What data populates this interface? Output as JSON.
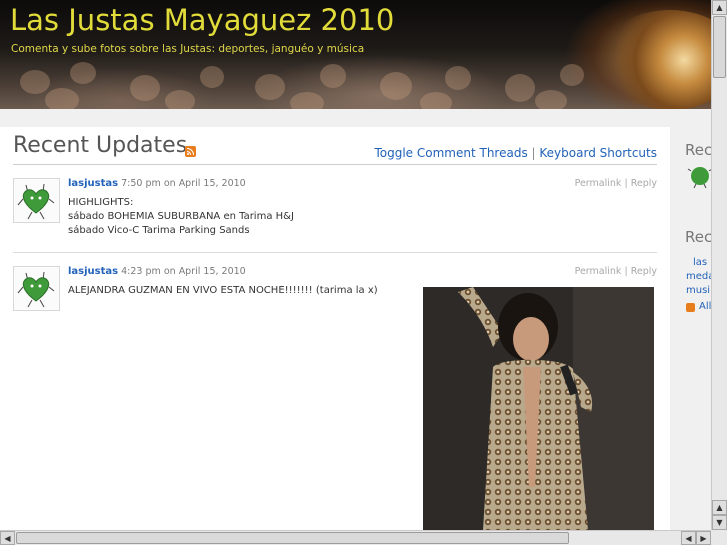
{
  "header": {
    "title": "Las Justas Mayaguez 2010",
    "description": "Comenta y sube fotos sobre las Justas: deportes, janguéo y música"
  },
  "main": {
    "page_title": "Recent Updates",
    "toggle_link": "Toggle Comment Threads",
    "separator": "|",
    "shortcuts_link": "Keyboard Shortcuts"
  },
  "posts": [
    {
      "author": "lasjustas",
      "time": "7:50 pm",
      "on": "on",
      "date": "April 15, 2010",
      "permalink": "Permalink",
      "reply": "Reply",
      "lines": [
        "HIGHLIGHTS:",
        "sábado BOHEMIA SUBURBANA en Tarima H&J",
        "sábado Vico-C Tarima Parking Sands"
      ]
    },
    {
      "author": "lasjustas",
      "time": "4:23 pm",
      "on": "on",
      "date": "April 15, 2010",
      "permalink": "Permalink",
      "reply": "Reply",
      "lines": [
        "ALEJANDRA GUZMAN EN VIVO ESTA NOCHE!!!!!!! (tarima la x)"
      ]
    }
  ],
  "sidebar": {
    "head1": "Rec",
    "head2": "Rec",
    "links": [
      "las",
      "meda",
      "musi",
      "All"
    ]
  },
  "colors": {
    "title": "#e2dc3a",
    "link": "#2262b8",
    "rss": "#e87d1e"
  },
  "icons": {
    "rss": "rss-feed-icon",
    "avatar": "green-heart-mascot-avatar"
  }
}
